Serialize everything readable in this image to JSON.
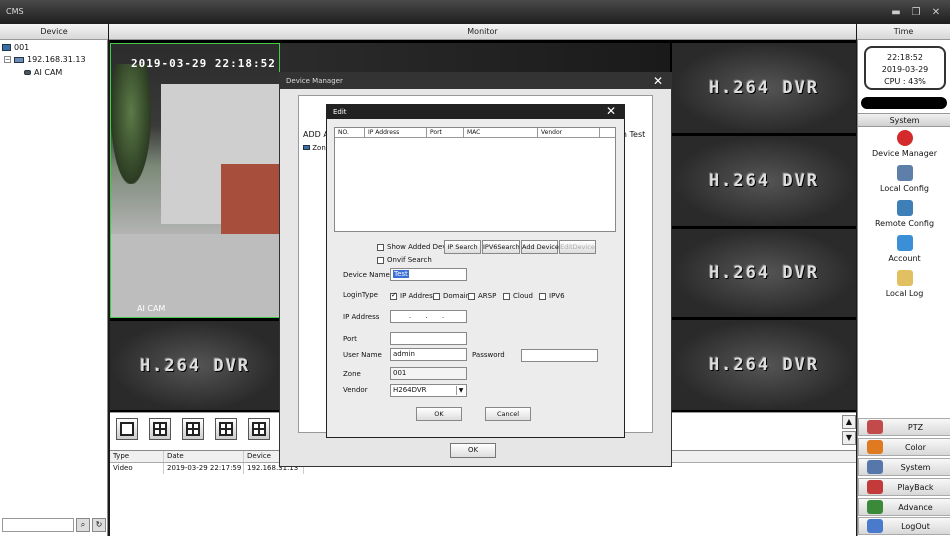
{
  "app": {
    "title": "CMS"
  },
  "headers": {
    "device": "Device",
    "monitor": "Monitor",
    "time": "Time"
  },
  "tree": {
    "root": "001",
    "ip": "192.168.31.13",
    "camera": "AI CAM"
  },
  "camera_feed": {
    "timestamp": "2019-03-29 22:18:52",
    "name": "AI CAM"
  },
  "dvr_tile_text": "H.264 DVR",
  "clock": {
    "time": "22:18:52",
    "date": "2019-03-29",
    "cpu": "CPU : 43%"
  },
  "system_panel": {
    "header": "System",
    "items": [
      {
        "label": "Device Manager",
        "icon": "device-manager-icon",
        "color": "#d32b2b"
      },
      {
        "label": "Local Config",
        "icon": "local-config-icon",
        "color": "#5d7fa8"
      },
      {
        "label": "Remote Config",
        "icon": "remote-config-icon",
        "color": "#3f7fb8"
      },
      {
        "label": "Account",
        "icon": "account-icon",
        "color": "#3b8fd6"
      },
      {
        "label": "Local Log",
        "icon": "local-log-icon",
        "color": "#e0c060"
      }
    ]
  },
  "controls": [
    {
      "label": "PTZ",
      "icon": "ptz-icon",
      "color": "#c24a4a"
    },
    {
      "label": "Color",
      "icon": "color-icon",
      "color": "#e07a20"
    },
    {
      "label": "System",
      "icon": "system-icon",
      "color": "#5577aa"
    },
    {
      "label": "PlayBack",
      "icon": "playback-icon",
      "color": "#c23a3a"
    },
    {
      "label": "Advance",
      "icon": "advance-icon",
      "color": "#3a8a3a"
    },
    {
      "label": "LogOut",
      "icon": "logout-icon",
      "color": "#4a7acc"
    }
  ],
  "log": {
    "columns": [
      "Type",
      "Date",
      "Device"
    ],
    "rows": [
      {
        "type": "Video",
        "date": "2019-03-29 22:17:59",
        "device": "192.168.31.13"
      }
    ]
  },
  "device_manager": {
    "title": "Device Manager",
    "add_area_label": "ADD AR",
    "zone_label": "Zone",
    "connection_test_label": "on Test",
    "ok_label": "OK"
  },
  "edit_dialog": {
    "title": "Edit",
    "table_columns": [
      "NO.",
      "IP Address",
      "Port",
      "MAC",
      "Vendor"
    ],
    "show_added_devices": "Show Added Devi",
    "onvif_search": "Onvif Search",
    "buttons": {
      "ip_search": "IP Search",
      "ipv6_search": "IPV6Search",
      "add_device": "Add Device",
      "edit_device": "EditDevice"
    },
    "fields": {
      "device_name_label": "Device Name",
      "device_name_value": "Test",
      "login_type_label": "LoginType",
      "login_options": [
        "IP Address",
        "Domain",
        "ARSP",
        "Cloud",
        "IPV6"
      ],
      "ip_address_label": "IP Address",
      "ip_address_value": ". . .",
      "port_label": "Port",
      "port_value": "",
      "user_name_label": "User Name",
      "user_name_value": "admin",
      "password_label": "Password",
      "password_value": "",
      "zone_label": "Zone",
      "zone_value": "001",
      "vendor_label": "Vendor",
      "vendor_value": "H264DVR"
    },
    "ok_label": "OK",
    "cancel_label": "Cancel"
  }
}
